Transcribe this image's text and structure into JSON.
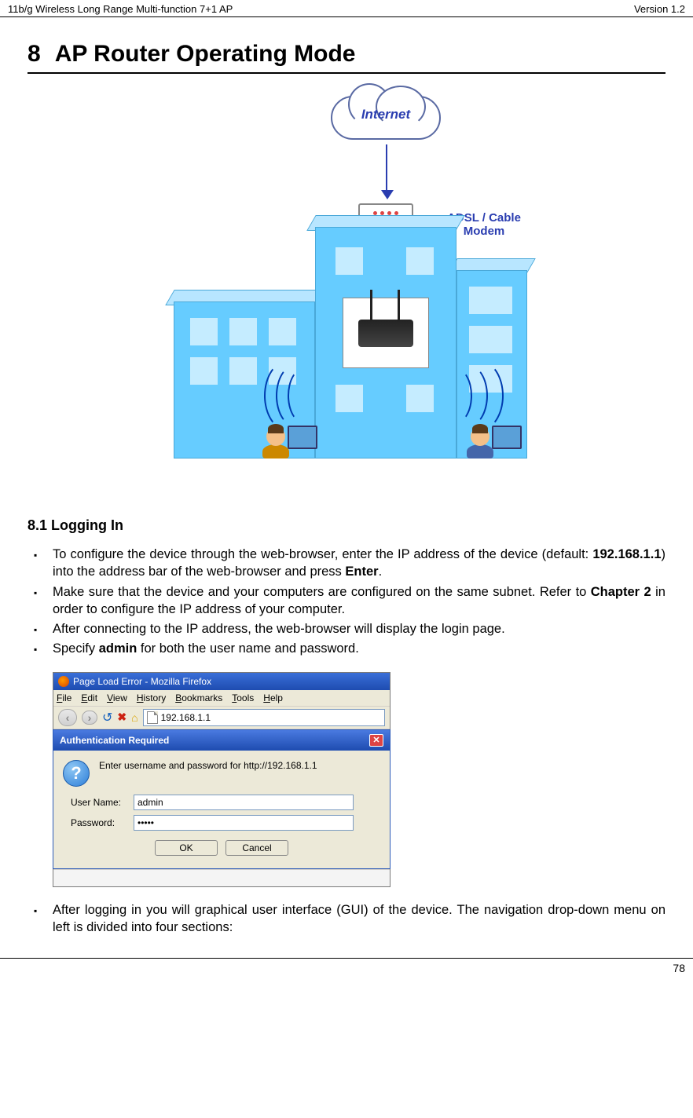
{
  "header": {
    "left": "11b/g Wireless Long Range Multi-function 7+1 AP",
    "right": "Version 1.2"
  },
  "chapter": {
    "number": "8",
    "title": "AP Router Operating Mode"
  },
  "diagram": {
    "cloud": "Internet",
    "modem": "ADSL / Cable Modem"
  },
  "section": {
    "num": "8.1",
    "title": "Logging In"
  },
  "bullets": {
    "b1a": "To configure the device through the web-browser, enter the IP address of the device (default: ",
    "b1ip": "192.168.1.1",
    "b1b": ") into the address bar of the web-browser and press ",
    "b1c": "Enter",
    "b1d": ".",
    "b2a": "Make sure that the device and your computers are configured on the same subnet. Refer to ",
    "b2b": "Chapter 2",
    "b2c": " in order to configure the IP address of your computer.",
    "b3": "After connecting to the IP address, the web-browser will display the login page.",
    "b4a": "Specify ",
    "b4b": "admin",
    "b4c": " for both the user name and password.",
    "b5": "After logging in you will graphical user interface (GUI) of the device. The navigation drop-down menu on left is divided into four sections:"
  },
  "firefox": {
    "title": "Page Load Error - Mozilla Firefox",
    "menus": [
      "File",
      "Edit",
      "View",
      "History",
      "Bookmarks",
      "Tools",
      "Help"
    ],
    "url": "192.168.1.1"
  },
  "auth": {
    "title": "Authentication Required",
    "message": "Enter username and password for http://192.168.1.1",
    "username_label": "User Name:",
    "password_label": "Password:",
    "username_value": "admin",
    "password_value": "•••••",
    "ok": "OK",
    "cancel": "Cancel"
  },
  "footer": {
    "page": "78"
  }
}
